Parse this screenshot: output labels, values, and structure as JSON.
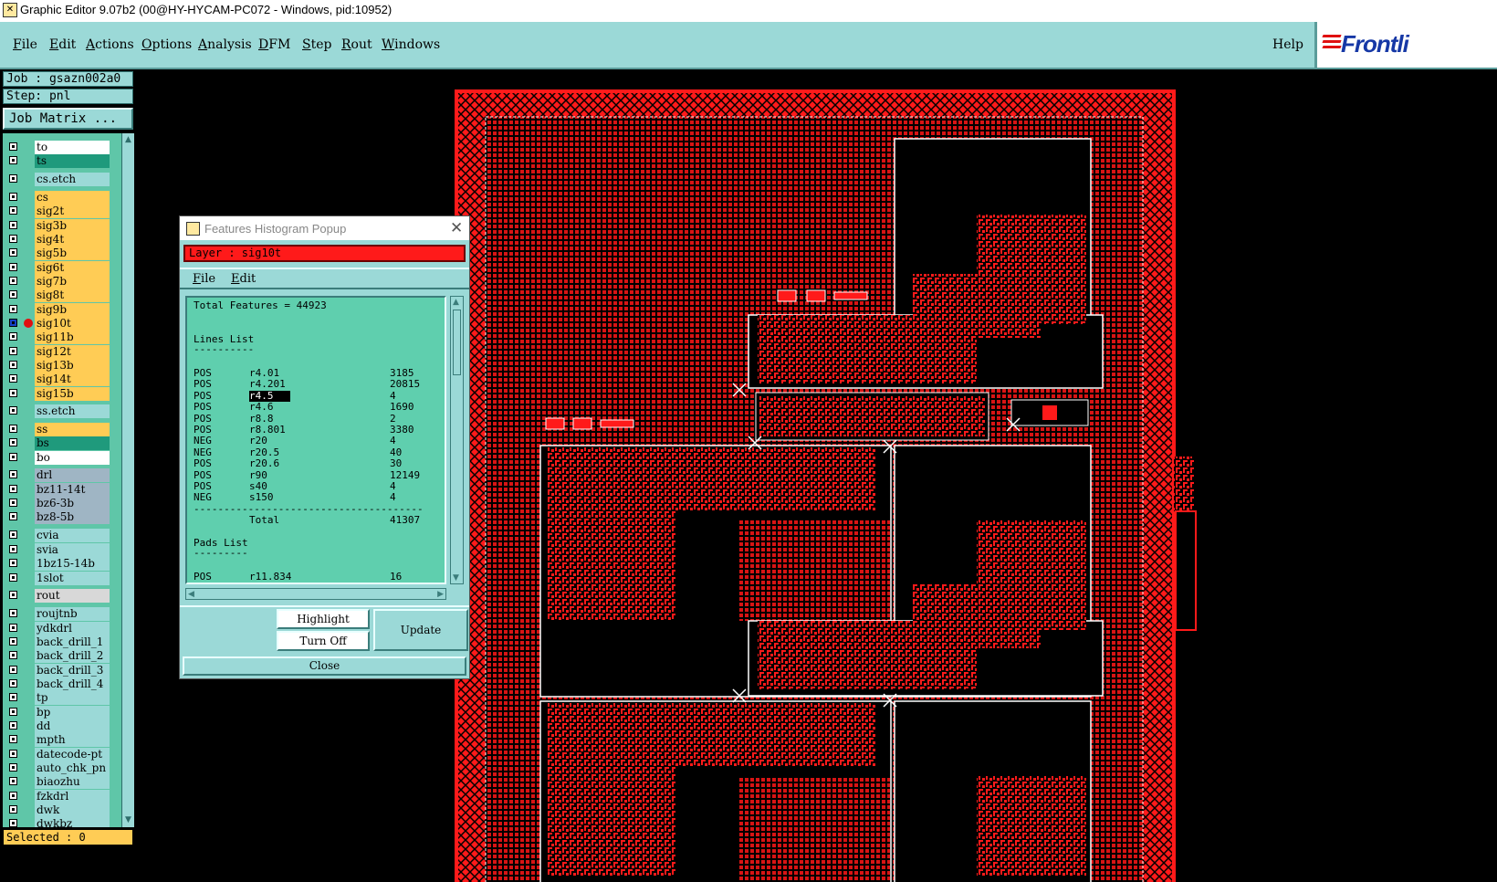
{
  "window": {
    "title": "Graphic Editor 9.07b2 (00@HY-HYCAM-PC072 - Windows, pid:10952)"
  },
  "menu": {
    "items": [
      {
        "label": "File",
        "u": "F",
        "rest": "ile"
      },
      {
        "label": "Edit",
        "u": "E",
        "rest": "dit"
      },
      {
        "label": "Actions",
        "u": "A",
        "rest": "ctions"
      },
      {
        "label": "Options",
        "u": "O",
        "rest": "ptions"
      },
      {
        "label": "Analysis",
        "u": "A",
        "rest": "nalysis"
      },
      {
        "label": "DFM",
        "u": "D",
        "rest": "FM"
      },
      {
        "label": "Step",
        "u": "S",
        "rest": "tep"
      },
      {
        "label": "Rout",
        "u": "R",
        "rest": "out"
      },
      {
        "label": "Windows",
        "u": "W",
        "rest": "indows"
      }
    ],
    "help": "Help"
  },
  "logo": {
    "text": "Frontline",
    "visible_text": "Frontli"
  },
  "left": {
    "job": "Job : gsazn002a0",
    "step": "Step: pnl",
    "job_matrix": "Job Matrix ...",
    "selected": "Selected : 0"
  },
  "layers": [
    {
      "name": "to",
      "color": "#ffffff"
    },
    {
      "name": "ts",
      "color": "#1f9a7c"
    },
    {
      "name": "cs.etch",
      "color": "#9bd9d7"
    },
    {
      "name": "cs",
      "color": "#ffcc55"
    },
    {
      "name": "sig2t",
      "color": "#ffcc55"
    },
    {
      "name": "sig3b",
      "color": "#ffcc55"
    },
    {
      "name": "sig4t",
      "color": "#ffcc55"
    },
    {
      "name": "sig5b",
      "color": "#ffcc55"
    },
    {
      "name": "sig6t",
      "color": "#ffcc55"
    },
    {
      "name": "sig7b",
      "color": "#ffcc55"
    },
    {
      "name": "sig8t",
      "color": "#ffcc55"
    },
    {
      "name": "sig9b",
      "color": "#ffcc55"
    },
    {
      "name": "sig10t",
      "color": "#ffcc55",
      "active": true
    },
    {
      "name": "sig11b",
      "color": "#ffcc55"
    },
    {
      "name": "sig12t",
      "color": "#ffcc55"
    },
    {
      "name": "sig13b",
      "color": "#ffcc55"
    },
    {
      "name": "sig14t",
      "color": "#ffcc55"
    },
    {
      "name": "sig15b",
      "color": "#ffcc55"
    },
    {
      "name": "ss.etch",
      "color": "#9bd9d7"
    },
    {
      "name": "ss",
      "color": "#ffcc55"
    },
    {
      "name": "bs",
      "color": "#1f9a7c"
    },
    {
      "name": "bo",
      "color": "#ffffff"
    },
    {
      "name": "drl",
      "color": "#9fb5c4"
    },
    {
      "name": "bz11-14t",
      "color": "#9fb5c4"
    },
    {
      "name": "bz6-3b",
      "color": "#9fb5c4"
    },
    {
      "name": "bz8-5b",
      "color": "#9fb5c4"
    },
    {
      "name": "cvia",
      "color": "#9bd9d7"
    },
    {
      "name": "svia",
      "color": "#9bd9d7"
    },
    {
      "name": "1bz15-14b",
      "color": "#9bd9d7"
    },
    {
      "name": "1slot",
      "color": "#9bd9d7"
    },
    {
      "name": "rout",
      "color": "#d8d8d8"
    },
    {
      "name": "roujtnb",
      "color": "#9bd9d7"
    },
    {
      "name": "ydkdrl",
      "color": "#9bd9d7"
    },
    {
      "name": "back_drill_1",
      "color": "#9bd9d7"
    },
    {
      "name": "back_drill_2",
      "color": "#9bd9d7"
    },
    {
      "name": "back_drill_3",
      "color": "#9bd9d7"
    },
    {
      "name": "back_drill_4",
      "color": "#9bd9d7"
    },
    {
      "name": "tp",
      "color": "#9bd9d7"
    },
    {
      "name": "bp",
      "color": "#9bd9d7"
    },
    {
      "name": "dd",
      "color": "#9bd9d7"
    },
    {
      "name": "mpth",
      "color": "#9bd9d7"
    },
    {
      "name": "datecode-pt",
      "color": "#9bd9d7"
    },
    {
      "name": "auto_chk_pn",
      "color": "#9bd9d7"
    },
    {
      "name": "biaozhu",
      "color": "#9bd9d7"
    },
    {
      "name": "fzkdrl",
      "color": "#9bd9d7"
    },
    {
      "name": "dwk",
      "color": "#9bd9d7"
    },
    {
      "name": "dwkbz",
      "color": "#9bd9d7"
    }
  ],
  "popup": {
    "title": "Features Histogram Popup",
    "layer_label": "Layer :  sig10t",
    "menu": [
      {
        "u": "F",
        "rest": "ile"
      },
      {
        "u": "E",
        "rest": "dit"
      }
    ],
    "total_features": "Total Features = 44923",
    "lines_title": "Lines List",
    "underline1": "----------",
    "lines": [
      {
        "pol": "POS",
        "sym": "r4.01",
        "count": "3185"
      },
      {
        "pol": "POS",
        "sym": "r4.201",
        "count": "20815"
      },
      {
        "pol": "POS",
        "sym": "r4.5",
        "count": "4",
        "highlight": true
      },
      {
        "pol": "POS",
        "sym": "r4.6",
        "count": "1690"
      },
      {
        "pol": "POS",
        "sym": "r8.8",
        "count": "2"
      },
      {
        "pol": "POS",
        "sym": "r8.801",
        "count": "3380"
      },
      {
        "pol": "NEG",
        "sym": "r20",
        "count": "4"
      },
      {
        "pol": "NEG",
        "sym": "r20.5",
        "count": "40"
      },
      {
        "pol": "POS",
        "sym": "r20.6",
        "count": "30"
      },
      {
        "pol": "POS",
        "sym": "r90",
        "count": "12149"
      },
      {
        "pol": "POS",
        "sym": "s40",
        "count": "4"
      },
      {
        "pol": "NEG",
        "sym": "s150",
        "count": "4"
      }
    ],
    "separator": "--------------------------------------",
    "total_label": "Total",
    "total_value": "41307",
    "pads_title": "Pads List",
    "underline2": "---------",
    "pads": [
      {
        "pol": "POS",
        "sym": "r11.834",
        "count": "16"
      }
    ],
    "buttons": {
      "highlight": "Highlight",
      "turn_off": "Turn Off",
      "update": "Update",
      "close": "Close"
    }
  },
  "colors": {
    "teal": "#9bd9d7",
    "list_bg": "#5fc6a8",
    "copper": "#ff1a1a",
    "canvas": "#000000"
  }
}
